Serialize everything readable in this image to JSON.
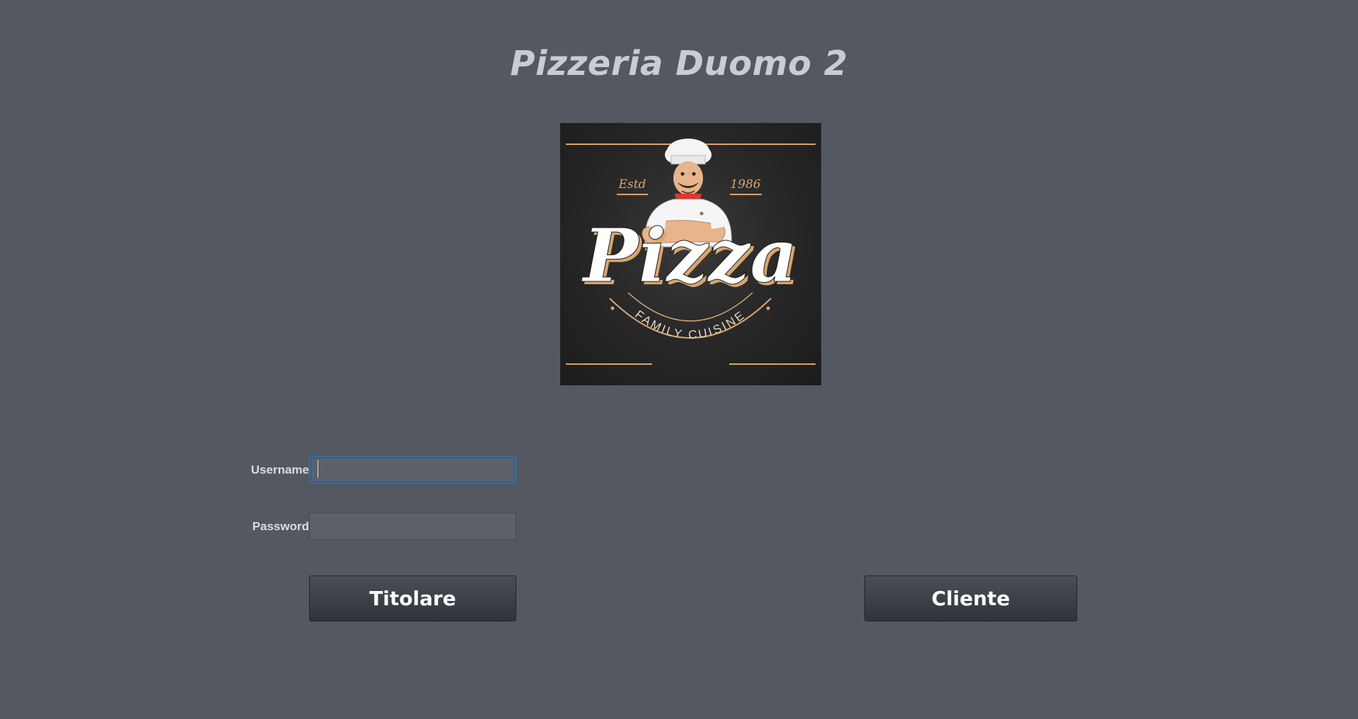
{
  "app": {
    "title": "Pizzeria Duomo 2"
  },
  "logo": {
    "icon": "chef-pizza-logo",
    "estd_label": "Estd",
    "year": "1986",
    "wordmark": "Pizza",
    "tagline": "FAMILY CUISINE"
  },
  "login": {
    "username_label": "Username",
    "username_value": "",
    "password_label": "Password",
    "password_value": ""
  },
  "buttons": {
    "titolare_label": "Titolare",
    "cliente_label": "Cliente"
  },
  "colors": {
    "background": "#535861",
    "focus_border": "#3a6fa5",
    "logo_accent": "#d9a56e"
  }
}
